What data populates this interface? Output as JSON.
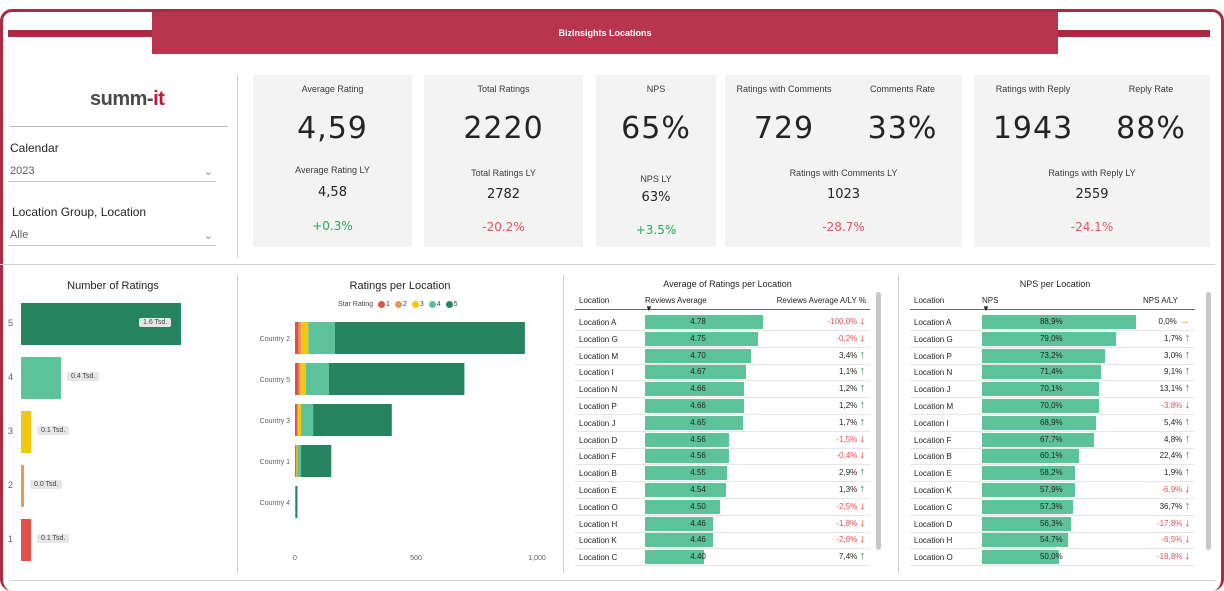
{
  "header": {
    "title": "BizInsights Locations"
  },
  "logo": {
    "text_main": "summ-",
    "text_accent": "it"
  },
  "filters": {
    "calendar": {
      "label": "Calendar",
      "value": "2023"
    },
    "location": {
      "label": "Location Group, Location",
      "value": "Alle"
    }
  },
  "kpis": {
    "avg_rating": {
      "label": "Average Rating",
      "value": "4,59",
      "ly_label": "Average Rating LY",
      "ly_value": "4,58",
      "delta": "+0.3%"
    },
    "total_ratings": {
      "label": "Total Ratings",
      "value": "2220",
      "ly_label": "Total Ratings LY",
      "ly_value": "2782",
      "delta": "-20.2%"
    },
    "nps": {
      "label": "NPS",
      "value": "65%",
      "ly_label": "NPS LY",
      "ly_value": "63%",
      "delta": "+3.5%"
    },
    "comments": {
      "label": "Ratings with Comments",
      "value": "729",
      "rate_label": "Comments Rate",
      "rate_value": "33%",
      "ly_label": "Ratings with Comments LY",
      "ly_value": "1023",
      "delta": "-28.7%"
    },
    "reply": {
      "label": "Ratings with Reply",
      "value": "1943",
      "rate_label": "Reply Rate",
      "rate_value": "88%",
      "ly_label": "Ratings with Reply LY",
      "ly_value": "2559",
      "delta": "-24.1%"
    }
  },
  "colors": {
    "star1": "#e0514a",
    "star2": "#e8965a",
    "star3": "#f2c80f",
    "star4": "#5cc29a",
    "star5": "#25845f",
    "accent": "#a92a42"
  },
  "number_of_ratings": {
    "title": "Number of Ratings",
    "rows": [
      {
        "label": "5",
        "value": 1.6,
        "data_label": "1.6 Tsd.",
        "color": "#25845f"
      },
      {
        "label": "4",
        "value": 0.4,
        "data_label": "0.4 Tsd.",
        "color": "#5cc29a"
      },
      {
        "label": "3",
        "value": 0.1,
        "data_label": "0.1 Tsd.",
        "color": "#f2c80f"
      },
      {
        "label": "2",
        "value": 0.0,
        "data_label": "0.0 Tsd.",
        "color": "#e8965a"
      },
      {
        "label": "1",
        "value": 0.1,
        "data_label": "0.1 Tsd.",
        "color": "#e0514a"
      }
    ]
  },
  "chart_data": {
    "type": "bar",
    "title": "Ratings per Location",
    "legend_title": "Star Rating",
    "legend": [
      "1",
      "2",
      "3",
      "4",
      "5"
    ],
    "categories": [
      "Country 2",
      "Country 5",
      "Country 3",
      "Country 1",
      "Country 4"
    ],
    "series": [
      {
        "name": "1",
        "values": [
          15,
          15,
          8,
          3,
          0
        ]
      },
      {
        "name": "2",
        "values": [
          10,
          8,
          5,
          3,
          0
        ]
      },
      {
        "name": "3",
        "values": [
          30,
          22,
          12,
          4,
          0
        ]
      },
      {
        "name": "4",
        "values": [
          110,
          95,
          50,
          15,
          3
        ]
      },
      {
        "name": "5",
        "values": [
          785,
          560,
          325,
          125,
          7
        ]
      }
    ],
    "x_ticks": [
      "0",
      "500",
      "1,000"
    ],
    "xlim": [
      0,
      1000
    ]
  },
  "avg_table": {
    "title": "Average of Ratings per Location",
    "headers": [
      "Location",
      "Reviews Average",
      "Reviews Average A/LY %"
    ],
    "rows": [
      {
        "loc": "Location A",
        "avg": "4.78",
        "avg_num": 4.78,
        "delta": "-100,0%",
        "dir": "down"
      },
      {
        "loc": "Location G",
        "avg": "4.75",
        "avg_num": 4.75,
        "delta": "-0,2%",
        "dir": "down"
      },
      {
        "loc": "Location M",
        "avg": "4.70",
        "avg_num": 4.7,
        "delta": "3,4%",
        "dir": "up"
      },
      {
        "loc": "Location I",
        "avg": "4.67",
        "avg_num": 4.67,
        "delta": "1,1%",
        "dir": "up"
      },
      {
        "loc": "Location N",
        "avg": "4.66",
        "avg_num": 4.66,
        "delta": "1,2%",
        "dir": "up"
      },
      {
        "loc": "Location P",
        "avg": "4.66",
        "avg_num": 4.66,
        "delta": "1,2%",
        "dir": "up"
      },
      {
        "loc": "Location J",
        "avg": "4.65",
        "avg_num": 4.65,
        "delta": "1,7%",
        "dir": "up"
      },
      {
        "loc": "Location D",
        "avg": "4.56",
        "avg_num": 4.56,
        "delta": "-1,5%",
        "dir": "down"
      },
      {
        "loc": "Location F",
        "avg": "4.56",
        "avg_num": 4.56,
        "delta": "-0,4%",
        "dir": "down"
      },
      {
        "loc": "Location B",
        "avg": "4.55",
        "avg_num": 4.55,
        "delta": "2,9%",
        "dir": "up"
      },
      {
        "loc": "Location E",
        "avg": "4.54",
        "avg_num": 4.54,
        "delta": "1,3%",
        "dir": "up"
      },
      {
        "loc": "Location O",
        "avg": "4.50",
        "avg_num": 4.5,
        "delta": "-2,5%",
        "dir": "down"
      },
      {
        "loc": "Location H",
        "avg": "4.46",
        "avg_num": 4.46,
        "delta": "-1,8%",
        "dir": "down"
      },
      {
        "loc": "Location K",
        "avg": "4.46",
        "avg_num": 4.46,
        "delta": "-2,6%",
        "dir": "down"
      },
      {
        "loc": "Location C",
        "avg": "4.40",
        "avg_num": 4.4,
        "delta": "7,4%",
        "dir": "up"
      }
    ]
  },
  "nps_table": {
    "title": "NPS per Location",
    "headers": [
      "Location",
      "NPS",
      "NPS A/LY"
    ],
    "rows": [
      {
        "loc": "Location A",
        "nps": "88,9%",
        "nps_num": 88.9,
        "delta": "0,0%",
        "dir": "flat"
      },
      {
        "loc": "Location G",
        "nps": "79,0%",
        "nps_num": 79.0,
        "delta": "1,7%",
        "dir": "up"
      },
      {
        "loc": "Location P",
        "nps": "73,2%",
        "nps_num": 73.2,
        "delta": "3,0%",
        "dir": "up"
      },
      {
        "loc": "Location N",
        "nps": "71,4%",
        "nps_num": 71.4,
        "delta": "9,1%",
        "dir": "up"
      },
      {
        "loc": "Location J",
        "nps": "70,1%",
        "nps_num": 70.1,
        "delta": "13,1%",
        "dir": "up"
      },
      {
        "loc": "Location M",
        "nps": "70,0%",
        "nps_num": 70.0,
        "delta": "-3,8%",
        "dir": "down"
      },
      {
        "loc": "Location I",
        "nps": "68,9%",
        "nps_num": 68.9,
        "delta": "5,4%",
        "dir": "up"
      },
      {
        "loc": "Location F",
        "nps": "67,7%",
        "nps_num": 67.7,
        "delta": "4,8%",
        "dir": "up"
      },
      {
        "loc": "Location B",
        "nps": "60,1%",
        "nps_num": 60.1,
        "delta": "22,4%",
        "dir": "up"
      },
      {
        "loc": "Location E",
        "nps": "58,2%",
        "nps_num": 58.2,
        "delta": "1,9%",
        "dir": "up"
      },
      {
        "loc": "Location K",
        "nps": "57,9%",
        "nps_num": 57.9,
        "delta": "-6,9%",
        "dir": "down"
      },
      {
        "loc": "Location C",
        "nps": "57,3%",
        "nps_num": 57.3,
        "delta": "36,7%",
        "dir": "up"
      },
      {
        "loc": "Location D",
        "nps": "56,3%",
        "nps_num": 56.3,
        "delta": "-17,8%",
        "dir": "down"
      },
      {
        "loc": "Location H",
        "nps": "54,7%",
        "nps_num": 54.7,
        "delta": "-6,5%",
        "dir": "down"
      },
      {
        "loc": "Location O",
        "nps": "50,0%",
        "nps_num": 50.0,
        "delta": "-18,8%",
        "dir": "down"
      }
    ]
  }
}
